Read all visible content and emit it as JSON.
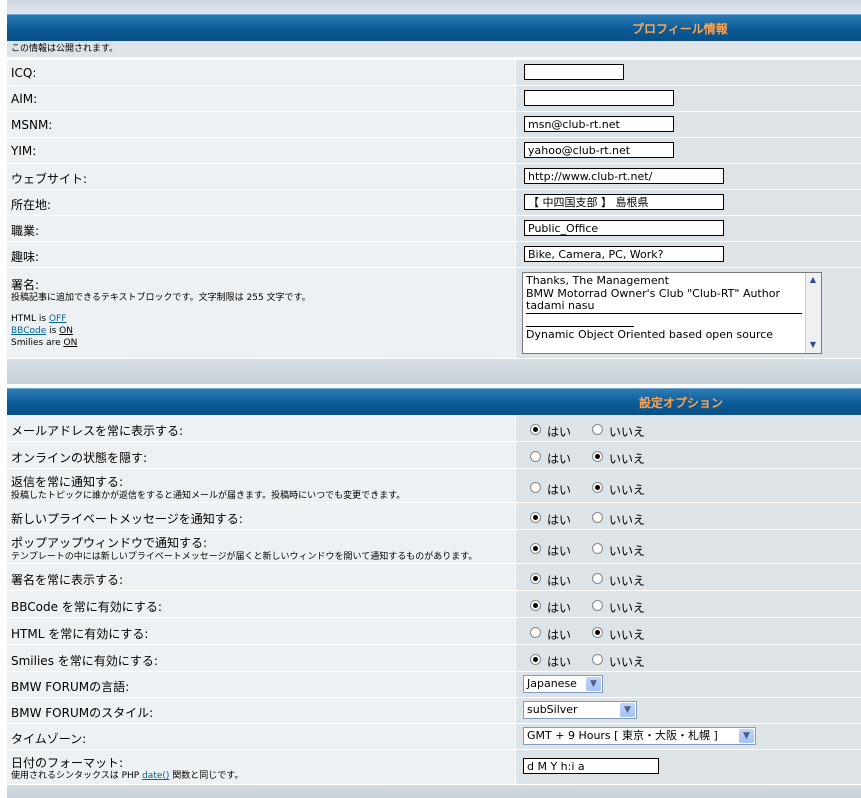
{
  "profile": {
    "header": "プロフィール情報",
    "note": "この情報は公開されます。",
    "fields": [
      {
        "label": "ICQ:",
        "value": ""
      },
      {
        "label": "AIM:",
        "value": ""
      },
      {
        "label": "MSNM:",
        "value": "msn@club-rt.net"
      },
      {
        "label": "YIM:",
        "value": "yahoo@club-rt.net"
      },
      {
        "label": "ウェブサイト:",
        "value": "http://www.club-rt.net/"
      },
      {
        "label": "所在地:",
        "value": "【 中四国支部 】 島根県"
      },
      {
        "label": "職業:",
        "value": "Public_Office"
      },
      {
        "label": "趣味:",
        "value": "Bike, Camera, PC, Work?"
      }
    ],
    "signature": {
      "label": "署名:",
      "desc": "投稿記事に追加できるテキストブロックです。文字制限は 255 文字です。",
      "html_prefix": "HTML is ",
      "html_state": "OFF",
      "bbcode_link": "BBCode",
      "bbcode_mid": " is ",
      "bbcode_state": "ON",
      "smilies_prefix": "Smilies are ",
      "smilies_state": "ON",
      "lines": [
        "Thanks, The Management",
        "BMW Motorrad Owner's Club \"Club-RT\"  Author",
        "tadami nasu",
        "",
        "Dynamic Object Oriented based open source"
      ]
    }
  },
  "options": {
    "header": "設定オプション",
    "yes": "はい",
    "no": "いいえ",
    "rows": [
      {
        "label": "メールアドレスを常に表示する:",
        "sub": "",
        "yes": true
      },
      {
        "label": "オンラインの状態を隠す:",
        "sub": "",
        "yes": false
      },
      {
        "label": "返信を常に通知する:",
        "sub": "投稿したトピックに誰かが返信をすると通知メールが届きます。投稿時にいつでも変更できます。",
        "yes": false
      },
      {
        "label": "新しいプライベートメッセージを通知する:",
        "sub": "",
        "yes": true
      },
      {
        "label": "ポップアップウィンドウで通知する:",
        "sub": "テンプレートの中には新しいプライベートメッセージが届くと新しいウィンドウを開いて通知するものがあります。",
        "yes": true
      },
      {
        "label": "署名を常に表示する:",
        "sub": "",
        "yes": true
      },
      {
        "label": "BBCode を常に有効にする:",
        "sub": "",
        "yes": true
      },
      {
        "label": "HTML を常に有効にする:",
        "sub": "",
        "yes": false
      },
      {
        "label": "Smilies を常に有効にする:",
        "sub": "",
        "yes": true
      }
    ],
    "language_label": "BMW FORUMの言語:",
    "language_value": "Japanese",
    "style_label": "BMW FORUMのスタイル:",
    "style_value": "subSilver",
    "timezone_label": "タイムゾーン:",
    "timezone_value": "GMT + 9 Hours [ 東京・大阪・札幌 ]",
    "dateformat_label": "日付のフォーマット:",
    "dateformat_sub_prefix": "使用されるシンタックスは PHP ",
    "dateformat_sub_link": "date()",
    "dateformat_sub_suffix": " 関数と同じです。",
    "dateformat_value": "d M Y h:i a"
  }
}
